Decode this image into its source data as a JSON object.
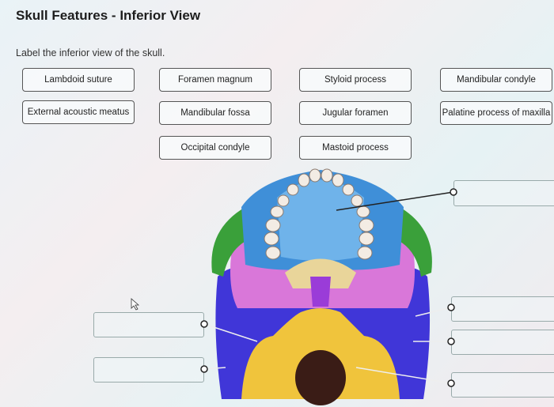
{
  "title": "Skull Features - Inferior View",
  "instruction": "Label the inferior view of the skull.",
  "labels": [
    "Lambdoid suture",
    "Foramen magnum",
    "Styloid process",
    "Mandibular condyle",
    "External acoustic meatus",
    "Mandibular fossa",
    "Jugular foramen",
    "Palatine process of maxilla",
    "Occipital condyle",
    "Mastoid process"
  ],
  "colors": {
    "maxilla": "#3f8fd8",
    "zygomatic": "#3aa03a",
    "sphenoid": "#d977d9",
    "temporal": "#4036d8",
    "occipital": "#f0c43c",
    "palatine": "#e9d59a"
  }
}
